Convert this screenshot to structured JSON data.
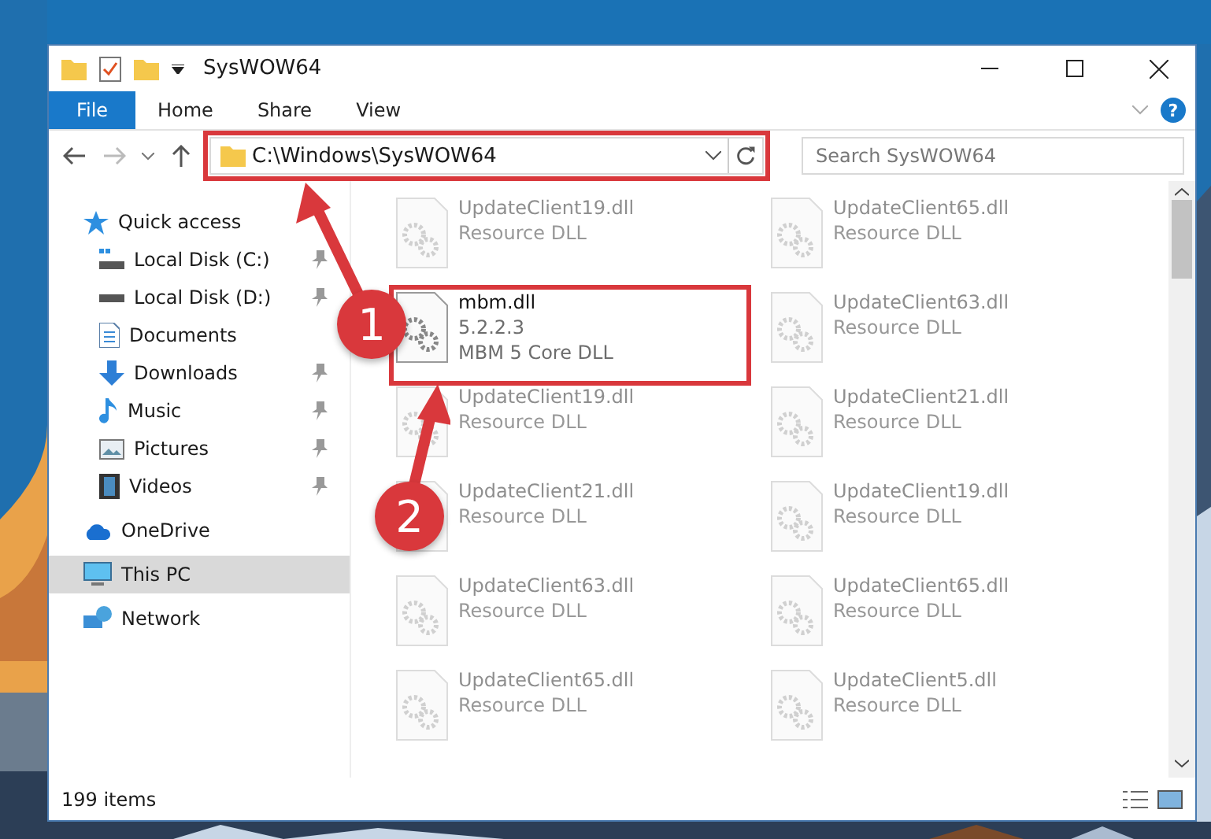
{
  "window": {
    "title": "SysWOW64"
  },
  "ribbon": {
    "tabs": [
      {
        "label": "File",
        "selected": true
      },
      {
        "label": "Home",
        "selected": false
      },
      {
        "label": "Share",
        "selected": false
      },
      {
        "label": "View",
        "selected": false
      }
    ],
    "help": "?"
  },
  "address": {
    "path": "C:\\Windows\\SysWOW64",
    "highlighted": true,
    "search_placeholder": "Search SysWOW64"
  },
  "sidebar": {
    "items": [
      {
        "label": "Quick access",
        "selected": false,
        "children": [
          {
            "label": "Local Disk (C:)",
            "pinned": true
          },
          {
            "label": "Local Disk (D:)",
            "pinned": true
          },
          {
            "label": "Documents",
            "pinned": false
          },
          {
            "label": "Downloads",
            "pinned": true
          },
          {
            "label": "Music",
            "pinned": true
          },
          {
            "label": "Pictures",
            "pinned": true
          },
          {
            "label": "Videos",
            "pinned": true
          }
        ]
      },
      {
        "label": "OneDrive",
        "selected": false
      },
      {
        "label": "This PC",
        "selected": true
      },
      {
        "label": "Network",
        "selected": false
      }
    ]
  },
  "files": [
    {
      "name": "UpdateClient19.dll",
      "details": [
        "Resource DLL"
      ],
      "blurred": true,
      "highlighted": false
    },
    {
      "name": "UpdateClient65.dll",
      "details": [
        "Resource DLL"
      ],
      "blurred": true,
      "highlighted": false
    },
    {
      "name": "mbm.dll",
      "details": [
        "5.2.2.3",
        "MBM 5 Core DLL"
      ],
      "blurred": false,
      "highlighted": true
    },
    {
      "name": "UpdateClient63.dll",
      "details": [
        "Resource DLL"
      ],
      "blurred": true,
      "highlighted": false
    },
    {
      "name": "UpdateClient19.dll",
      "details": [
        "Resource DLL"
      ],
      "blurred": true,
      "highlighted": false
    },
    {
      "name": "UpdateClient21.dll",
      "details": [
        "Resource DLL"
      ],
      "blurred": true,
      "highlighted": false
    },
    {
      "name": "UpdateClient21.dll",
      "details": [
        "Resource DLL"
      ],
      "blurred": true,
      "highlighted": false
    },
    {
      "name": "UpdateClient19.dll",
      "details": [
        "Resource DLL"
      ],
      "blurred": true,
      "highlighted": false
    },
    {
      "name": "UpdateClient63.dll",
      "details": [
        "Resource DLL"
      ],
      "blurred": true,
      "highlighted": false
    },
    {
      "name": "UpdateClient65.dll",
      "details": [
        "Resource DLL"
      ],
      "blurred": true,
      "highlighted": false
    },
    {
      "name": "UpdateClient65.dll",
      "details": [
        "Resource DLL"
      ],
      "blurred": true,
      "highlighted": false
    },
    {
      "name": "UpdateClient5.dll",
      "details": [
        "Resource DLL"
      ],
      "blurred": true,
      "highlighted": false
    }
  ],
  "status_bar": {
    "count": "199 items"
  },
  "callouts": [
    {
      "label": "1"
    },
    {
      "label": "2"
    }
  ]
}
